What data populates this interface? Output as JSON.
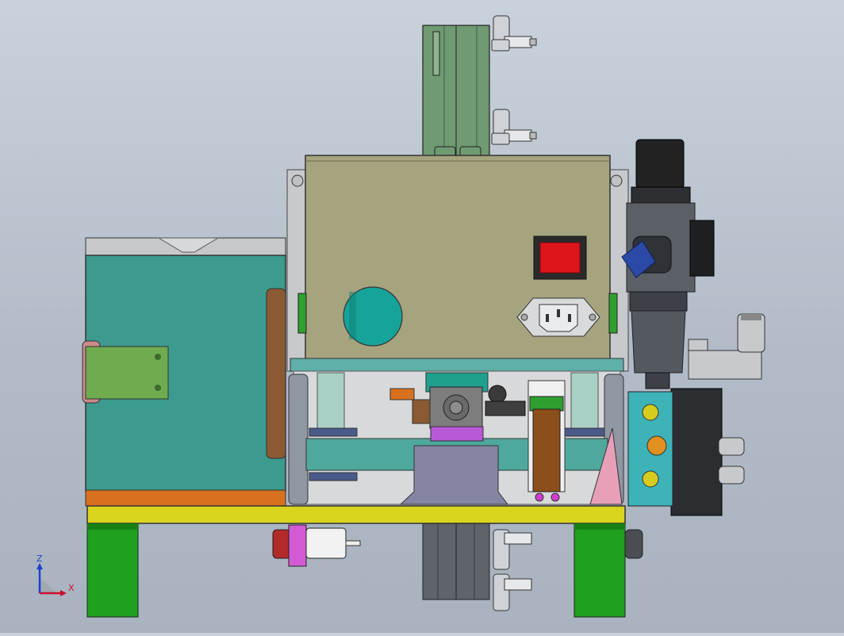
{
  "viewport": {
    "background_top": "#c9d2dc",
    "background_bottom": "#a9b3bf"
  },
  "triad": {
    "z_label": "Z",
    "x_label": "X",
    "z_color": "#1f3fd0",
    "x_color": "#c8102e"
  },
  "colors": {
    "housing": "#a6a37f",
    "teal_box": "#3c9a8f",
    "base_plate": "#d9d41e",
    "feet": "#1fa01f",
    "cylinder": "#6f9a72",
    "power_switch": "#e0151b",
    "purple_block": "#b85ad6",
    "orange_strip": "#d8711f",
    "filter_body": "#5b5f66"
  },
  "parts": {
    "power_switch": "rocker-switch",
    "power_inlet": "iec-c14-socket",
    "air_filter": "filter-regulator",
    "solenoid_valve": "solenoid-valve"
  }
}
